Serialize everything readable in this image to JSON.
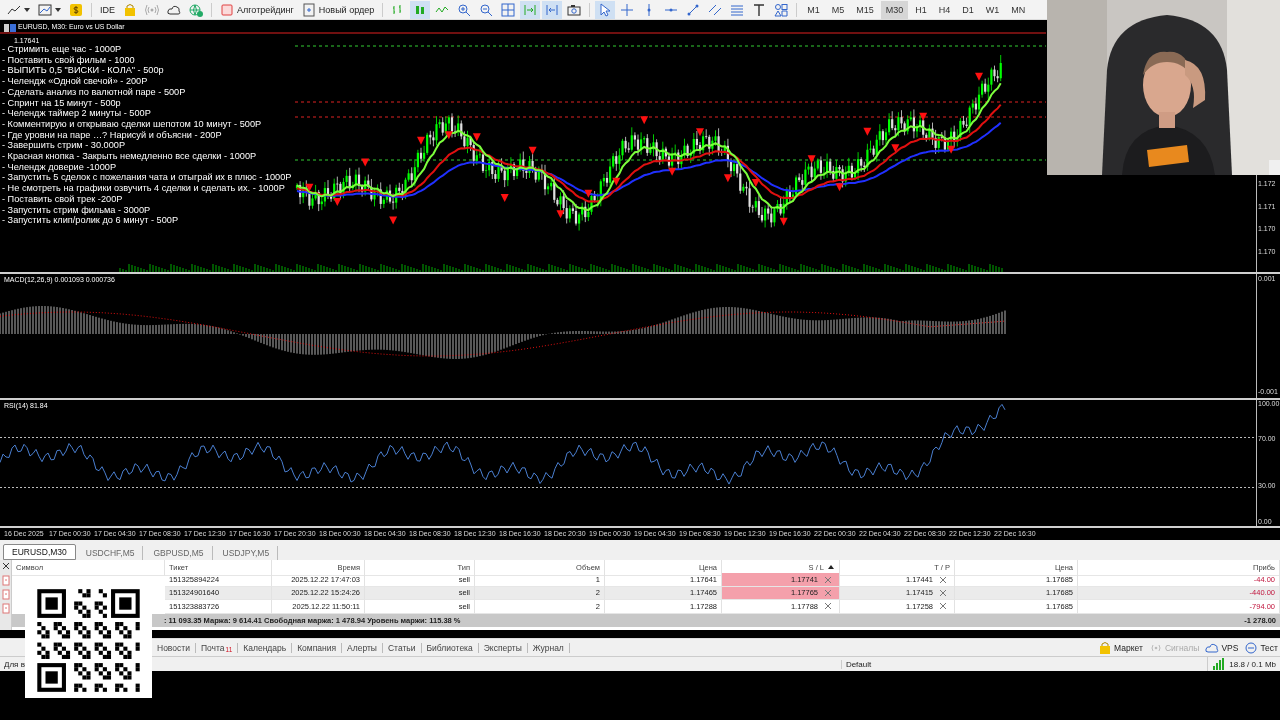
{
  "toolbar": {
    "ide": "IDE",
    "algo": "Алготрейдинг",
    "new_order": "Новый ордер",
    "timeframes": [
      {
        "label": "M1",
        "selected": false
      },
      {
        "label": "M5",
        "selected": false
      },
      {
        "label": "M15",
        "selected": false
      },
      {
        "label": "M30",
        "selected": true
      },
      {
        "label": "H1",
        "selected": false
      },
      {
        "label": "H4",
        "selected": false
      },
      {
        "label": "D1",
        "selected": false
      },
      {
        "label": "W1",
        "selected": false
      },
      {
        "label": "MN",
        "selected": false
      }
    ]
  },
  "chart": {
    "title": "EURUSD, M30:  Euro vs US Dollar",
    "trade_label": "1.17641",
    "overlay_lines": [
      "- Стримить еще час - 1000Р",
      "- Поставить свой фильм - 1000",
      "- ВЫПИТЬ 0,5 \"ВИСКИ - КОЛА\" - 500р",
      "- Челендж «Одной свечой» - 200Р",
      "- Сделать анализ по валютной паре - 500Р",
      "- Спринт на 15 минут - 500р",
      "- Челендж таймер 2 минуты - 500Р",
      "- Комментирую и открываю сделки шепотом 10 минут - 500Р",
      "- Где уровни на паре …? Нарисуй и объясни - 200Р",
      "- Завершить стрим - 30.000Р",
      "- Красная кнопка - Закрыть немедленно все сделки - 1000Р",
      "- Челендж доверие -1000Р",
      "- Запустить 5 сделок с пожелания чата и отыграй их в плюс - 1000Р",
      "- Не смотреть на графики озвучить 4 сделки и сделать их. - 1000Р",
      "- Поставить свой трек -200Р",
      "- Запустить стрим фильма - 3000Р",
      "- Запустить клип/ролик до 6 минут - 500Р"
    ],
    "price_ticks": [
      "1.172",
      "1.171",
      "1.170",
      "1.170"
    ],
    "macd": {
      "label": "MACD(12,26,9) 0.001093 0.000736",
      "ticks": [
        "0.001",
        "-0.001"
      ]
    },
    "rsi": {
      "label": "RSI(14) 81.84",
      "ticks": [
        "100.00",
        "70.00",
        "30.00",
        "0.00"
      ]
    },
    "time_ticks": [
      "16 Dec 2025",
      "17 Dec 00:30",
      "17 Dec 04:30",
      "17 Dec 08:30",
      "17 Dec 12:30",
      "17 Dec 16:30",
      "17 Dec 20:30",
      "18 Dec 00:30",
      "18 Dec 04:30",
      "18 Dec 08:30",
      "18 Dec 12:30",
      "18 Dec 16:30",
      "18 Dec 20:30",
      "19 Dec 00:30",
      "19 Dec 04:30",
      "19 Dec 08:30",
      "19 Dec 12:30",
      "19 Dec 16:30",
      "22 Dec 00:30",
      "22 Dec 04:30",
      "22 Dec 08:30",
      "22 Dec 12:30",
      "22 Dec 16:30"
    ]
  },
  "symbol_tabs": [
    {
      "label": "EURUSD,M30",
      "selected": true
    },
    {
      "label": "USDCHF,M5",
      "selected": false
    },
    {
      "label": "GBPUSD,M5",
      "selected": false
    },
    {
      "label": "USDJPY,M5",
      "selected": false
    }
  ],
  "trade_table": {
    "columns": [
      {
        "label": "Символ"
      },
      {
        "label": "Тикет"
      },
      {
        "label": "Время"
      },
      {
        "label": "Тип"
      },
      {
        "label": "Объем"
      },
      {
        "label": "Цена"
      },
      {
        "label": "S / L",
        "sorted": true
      },
      {
        "label": "T / P"
      },
      {
        "label": "Цена"
      },
      {
        "label": "Прибь"
      }
    ],
    "rows": [
      {
        "ticket": "151325894224",
        "time": "2025.12.22 17:47:03",
        "type": "sell",
        "volume": "1",
        "price": "1.17641",
        "sl": "1.17741",
        "sl_alert": true,
        "tp": "1.17441",
        "current_price": "1.17685",
        "profit": "-44.00",
        "selected": false
      },
      {
        "ticket": "151324901640",
        "time": "2025.12.22 15:24:26",
        "type": "sell",
        "volume": "2",
        "price": "1.17465",
        "sl": "1.17765",
        "sl_alert": true,
        "tp": "1.17415",
        "current_price": "1.17685",
        "profit": "-440.00",
        "selected": true
      },
      {
        "ticket": "151323883726",
        "time": "2025.12.22 11:50:11",
        "type": "sell",
        "volume": "2",
        "price": "1.17288",
        "sl": "1.17788",
        "sl_alert": false,
        "tp": "1.17258",
        "current_price": "1.17685",
        "profit": "-794.00",
        "selected": false
      }
    ],
    "summary": ": 11 093.35  Маржа: 9 614.41  Свободная маржа: 1 478.94  Уровень маржи: 115.38 %",
    "total": "-1 278.00"
  },
  "bottom_tabs": [
    {
      "label": "Новости"
    },
    {
      "label": "Почта",
      "badge": "11"
    },
    {
      "label": "Календарь"
    },
    {
      "label": "Компания"
    },
    {
      "label": "Алерты"
    },
    {
      "label": "Статьи"
    },
    {
      "label": "Библиотека"
    },
    {
      "label": "Эксперты"
    },
    {
      "label": "Журнал"
    }
  ],
  "right_tabs": [
    {
      "label": "Маркет",
      "kind": "market",
      "disabled": false
    },
    {
      "label": "Сигналы",
      "kind": "signals",
      "disabled": true
    },
    {
      "label": "VPS",
      "kind": "vps",
      "disabled": false
    },
    {
      "label": "Тест",
      "kind": "test",
      "disabled": false
    }
  ],
  "status_bar": {
    "left": "Для в",
    "profile": "Default",
    "traffic": "18.8 / 0.1 Mb"
  }
}
